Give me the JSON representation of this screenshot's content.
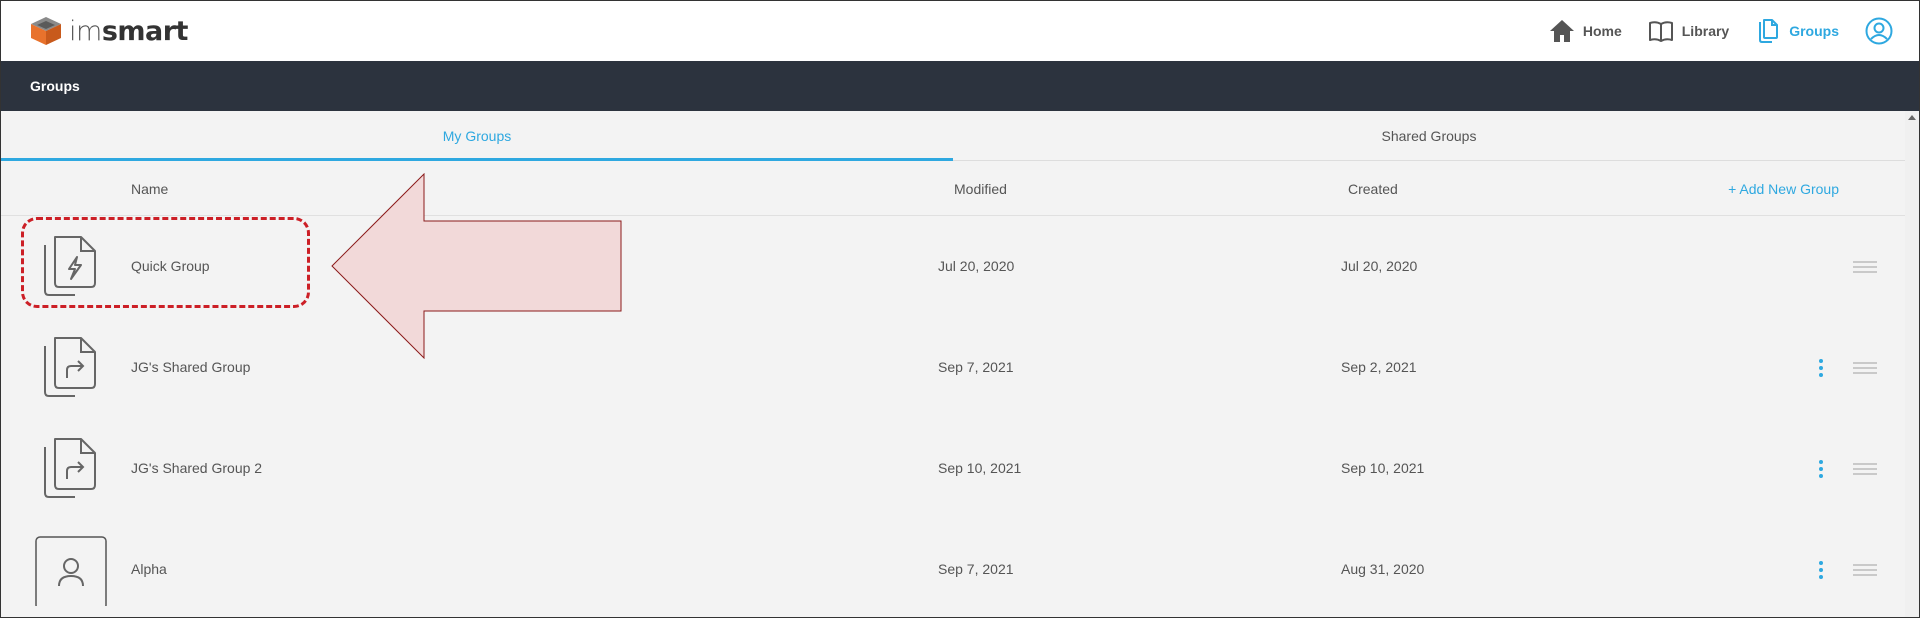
{
  "app": {
    "logo_light": "im",
    "logo_bold": "smart"
  },
  "nav": {
    "home": "Home",
    "library": "Library",
    "groups": "Groups",
    "active": "groups"
  },
  "titlebar": {
    "title": "Groups"
  },
  "tabs": [
    {
      "label": "My Groups",
      "active": true
    },
    {
      "label": "Shared Groups",
      "active": false
    }
  ],
  "table": {
    "columns": {
      "name": "Name",
      "modified": "Modified",
      "created": "Created"
    },
    "add_label": "+ Add New Group",
    "rows": [
      {
        "icon": "quick-group-icon",
        "name": "Quick Group",
        "modified": "Jul 20, 2020",
        "created": "Jul 20, 2020",
        "has_menu": false
      },
      {
        "icon": "shared-group-icon",
        "name": "JG's Shared Group",
        "modified": "Sep 7, 2021",
        "created": "Sep 2, 2021",
        "has_menu": true
      },
      {
        "icon": "shared-group-icon",
        "name": "JG's Shared Group 2",
        "modified": "Sep 10, 2021",
        "created": "Sep 10, 2021",
        "has_menu": true
      },
      {
        "icon": "person-group-icon",
        "name": "Alpha",
        "modified": "Sep 7, 2021",
        "created": "Aug 31, 2020",
        "has_menu": true
      }
    ]
  },
  "colors": {
    "accent": "#2ea8e0",
    "header_bg": "#2c333e",
    "annotation_red": "#cc1f26",
    "annotation_fill": "#f2d9d9"
  }
}
